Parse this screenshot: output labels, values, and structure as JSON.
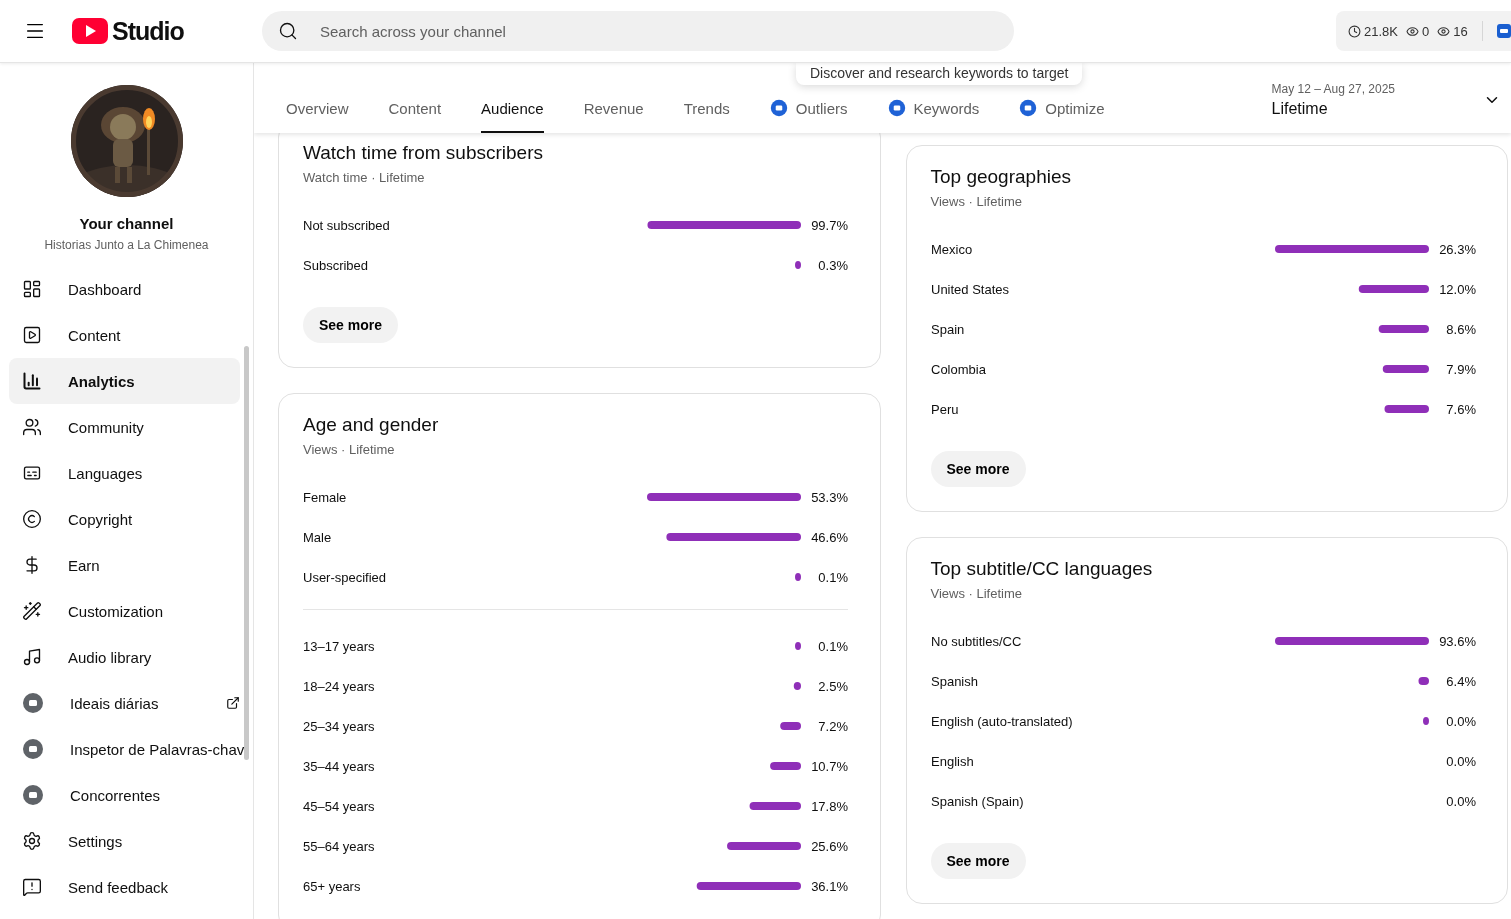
{
  "header": {
    "logo_text": "Studio",
    "search_placeholder": "Search across your channel",
    "stats": [
      {
        "kind": "clock",
        "value": "21.8K"
      },
      {
        "kind": "eye",
        "value": "0"
      },
      {
        "kind": "eye",
        "value": "16"
      }
    ]
  },
  "channel": {
    "title": "Your channel",
    "name": "Historias Junto a La Chimenea"
  },
  "sidebar": {
    "items": [
      {
        "kind": "dashboard",
        "label": "Dashboard",
        "selected": false,
        "external": false
      },
      {
        "kind": "content",
        "label": "Content",
        "selected": false,
        "external": false
      },
      {
        "kind": "analytics",
        "label": "Analytics",
        "selected": true,
        "external": false
      },
      {
        "kind": "community",
        "label": "Community",
        "selected": false,
        "external": false
      },
      {
        "kind": "languages",
        "label": "Languages",
        "selected": false,
        "external": false
      },
      {
        "kind": "copyright",
        "label": "Copyright",
        "selected": false,
        "external": false
      },
      {
        "kind": "earn",
        "label": "Earn",
        "selected": false,
        "external": false
      },
      {
        "kind": "customization",
        "label": "Customization",
        "selected": false,
        "external": false
      },
      {
        "kind": "audio",
        "label": "Audio library",
        "selected": false,
        "external": false
      },
      {
        "kind": "iq",
        "label": "Ideais diárias",
        "selected": false,
        "external": true
      },
      {
        "kind": "iq",
        "label": "Inspetor de Palavras-chav",
        "selected": false,
        "external": false
      },
      {
        "kind": "iq",
        "label": "Concorrentes",
        "selected": false,
        "external": false
      },
      {
        "kind": "settings",
        "label": "Settings",
        "selected": false,
        "external": false
      },
      {
        "kind": "feedback",
        "label": "Send feedback",
        "selected": false,
        "external": false
      }
    ]
  },
  "tabs": [
    {
      "kind": "plain",
      "label": "Overview",
      "selected": false
    },
    {
      "kind": "plain",
      "label": "Content",
      "selected": false
    },
    {
      "kind": "plain",
      "label": "Audience",
      "selected": true
    },
    {
      "kind": "plain",
      "label": "Revenue",
      "selected": false
    },
    {
      "kind": "plain",
      "label": "Trends",
      "selected": false
    },
    {
      "kind": "iq",
      "label": "Outliers",
      "selected": false
    },
    {
      "kind": "iq",
      "label": "Keywords",
      "selected": false
    },
    {
      "kind": "iq",
      "label": "Optimize",
      "selected": false
    }
  ],
  "tooltip": "Discover and research keywords to target",
  "date_range": {
    "range": "May 12 – Aug 27, 2025",
    "label": "Lifetime"
  },
  "columns": [
    [
      {
        "title": "Watch time from subscribers",
        "subtitle": "Watch time · Lifetime",
        "charts": [
          {
            "chart_data": {
              "type": "bar",
              "orientation": "horizontal",
              "categories": [
                "Not subscribed",
                "Subscribed"
              ],
              "values": [
                99.7,
                0.3
              ],
              "xlim": [
                100,
                0
              ],
              "value_labels": [
                "99.7%",
                "0.3%"
              ]
            }
          }
        ],
        "button": "See more"
      },
      {
        "title": "Age and gender",
        "subtitle": "Views · Lifetime",
        "charts": [
          {
            "chart_data": {
              "type": "bar",
              "orientation": "horizontal",
              "categories": [
                "Female",
                "Male",
                "User-specified"
              ],
              "values": [
                53.3,
                46.6,
                0.1
              ],
              "value_labels": [
                "53.3%",
                "46.6%",
                "0.1%"
              ]
            }
          },
          {
            "chart_data": {
              "type": "bar",
              "orientation": "horizontal",
              "categories": [
                "13–17 years",
                "18–24 years",
                "25–34 years",
                "35–44 years",
                "45–54 years",
                "55–64 years",
                "65+ years"
              ],
              "values": [
                0.1,
                2.5,
                7.2,
                10.7,
                17.8,
                25.6,
                36.1
              ],
              "value_labels": [
                "0.1%",
                "2.5%",
                "7.2%",
                "10.7%",
                "17.8%",
                "25.6%",
                "36.1%"
              ]
            }
          }
        ]
      }
    ],
    [
      {
        "title": "Top geographies",
        "subtitle": "Views · Lifetime",
        "charts": [
          {
            "chart_data": {
              "type": "bar",
              "orientation": "horizontal",
              "categories": [
                "Mexico",
                "United States",
                "Spain",
                "Colombia",
                "Peru"
              ],
              "values": [
                26.3,
                12.0,
                8.6,
                7.9,
                7.6
              ],
              "xlim": [
                26.3,
                0
              ],
              "value_labels": [
                "26.3%",
                "12.0%",
                "8.6%",
                "7.9%",
                "7.6%"
              ]
            }
          }
        ],
        "button": "See more"
      },
      {
        "title": "Top subtitle/CC languages",
        "subtitle": "Views · Lifetime",
        "charts": [
          {
            "chart_data": {
              "type": "bar",
              "orientation": "horizontal",
              "categories": [
                "No subtitles/CC",
                "Spanish",
                "English (auto-translated)",
                "English",
                "Spanish (Spain)"
              ],
              "values": [
                93.6,
                6.4,
                0.04,
                0,
                0
              ],
              "xlim": [
                93.6,
                0
              ],
              "value_labels": [
                "93.6%",
                "6.4%",
                "0.0%",
                "0.0%",
                "0.0%"
              ]
            }
          }
        ],
        "button": "See more"
      }
    ]
  ]
}
